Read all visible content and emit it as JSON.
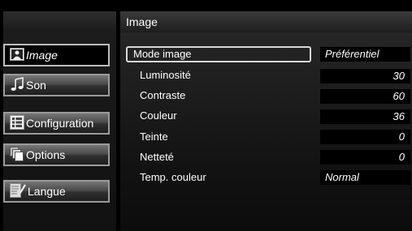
{
  "sidebar": {
    "items": [
      {
        "label": "Image",
        "icon": "picture-icon"
      },
      {
        "label": "Son",
        "icon": "music-note-icon"
      },
      {
        "label": "Configuration",
        "icon": "grid-icon"
      },
      {
        "label": "Options",
        "icon": "stacked-pages-icon"
      },
      {
        "label": "Langue",
        "icon": "language-icon"
      }
    ]
  },
  "header": {
    "title": "Image"
  },
  "settings": [
    {
      "label": "Mode image",
      "value": "Préférentiel"
    },
    {
      "label": "Luminosité",
      "value": "30"
    },
    {
      "label": "Contraste",
      "value": "60"
    },
    {
      "label": "Couleur",
      "value": "36"
    },
    {
      "label": "Teinte",
      "value": "0"
    },
    {
      "label": "Netteté",
      "value": "0"
    },
    {
      "label": "Temp. couleur",
      "value": "Normal"
    }
  ]
}
